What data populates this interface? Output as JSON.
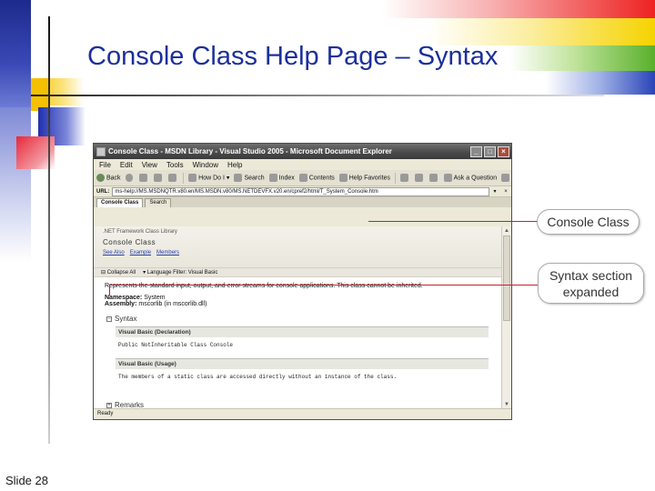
{
  "slide": {
    "title": "Console Class Help Page – Syntax",
    "slide_number": "Slide 28"
  },
  "window": {
    "title": "Console Class - MSDN Library - Visual Studio 2005 - Microsoft Document Explorer",
    "controls": [
      "_",
      "□",
      "×"
    ],
    "menu": [
      "File",
      "Edit",
      "View",
      "Tools",
      "Window",
      "Help"
    ],
    "toolbar": {
      "back": "Back",
      "how_do_i": "How Do I",
      "search": "Search",
      "index": "Index",
      "contents": "Contents",
      "help_favorites": "Help Favorites",
      "ask_a_question": "Ask a Question"
    },
    "url_label": "URL:",
    "url": "ms-help://MS.MSDNQTR.v80.en/MS.MSDN.v80/MS.NETDEVFX.v20.en/cpref2/html/T_System_Console.htm",
    "tabs": [
      "Console Class",
      "Search"
    ],
    "status": "Ready"
  },
  "page": {
    "breadcrumb": ".NET Framework Class Library",
    "topic_title": "Console Class",
    "links": [
      "See Also",
      "Example",
      "Members"
    ],
    "collapse_all": "Collapse All",
    "language_filter": "Language Filter: Visual Basic",
    "description": "Represents the standard input, output, and error streams for console applications. This class cannot be inherited.",
    "namespace_label": "Namespace:",
    "namespace_value": "System",
    "assembly_label": "Assembly:",
    "assembly_value": "mscorlib (in mscorlib.dll)",
    "syntax_heading": "Syntax",
    "declaration_heading": "Visual Basic (Declaration)",
    "declaration_code": "Public NotInheritable Class Console",
    "usage_heading": "Visual Basic (Usage)",
    "usage_code": "The members of a static class are accessed directly without an instance of the class.",
    "remarks_heading": "Remarks"
  },
  "callouts": {
    "console_class": "Console Class",
    "syntax_line1": "Syntax section",
    "syntax_line2": "expanded"
  }
}
